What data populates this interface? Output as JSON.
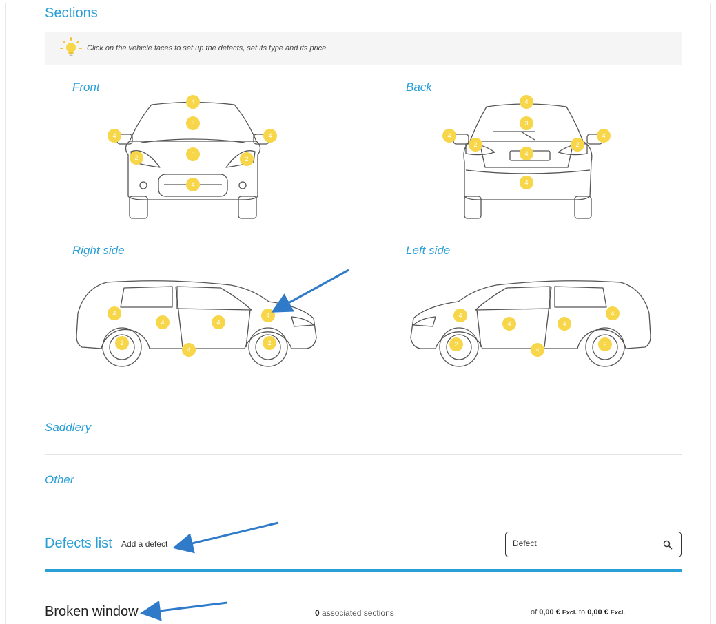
{
  "sections": {
    "title": "Sections",
    "hint": "Click on the vehicle faces to set up the defects, set its type and its price.",
    "faces": [
      {
        "label": "Front"
      },
      {
        "label": "Back"
      },
      {
        "label": "Right side"
      },
      {
        "label": "Left side"
      }
    ],
    "markers": {
      "front": [
        "4",
        "3",
        "4",
        "4",
        "5",
        "2",
        "2",
        "4"
      ],
      "back": [
        "4",
        "3",
        "4",
        "4",
        "2",
        "4",
        "2",
        "4"
      ],
      "right": [
        "4",
        "4",
        "4",
        "4",
        "2",
        "4",
        "2"
      ],
      "left": [
        "4",
        "4",
        "4",
        "4",
        "2",
        "4",
        "2"
      ]
    },
    "groups": {
      "saddlery": "Saddlery",
      "other": "Other"
    }
  },
  "defects": {
    "title": "Defects list",
    "add_label": "Add a defect",
    "search": {
      "value": "Defect",
      "placeholder": "Defect"
    },
    "items": [
      {
        "name": "Broken window",
        "count": "0",
        "count_suffix": "associated sections",
        "price_prefix": "of",
        "price_from": "0,00 €",
        "excl": "Excl.",
        "price_to_word": "to",
        "price_to": "0,00 €"
      }
    ]
  },
  "colors": {
    "accent": "#2a9fd6",
    "marker": "#f7d64a",
    "annotation_arrow": "#2f7ac9"
  },
  "icons": [
    "lightbulb-icon",
    "search-icon",
    "annotation-arrow"
  ]
}
